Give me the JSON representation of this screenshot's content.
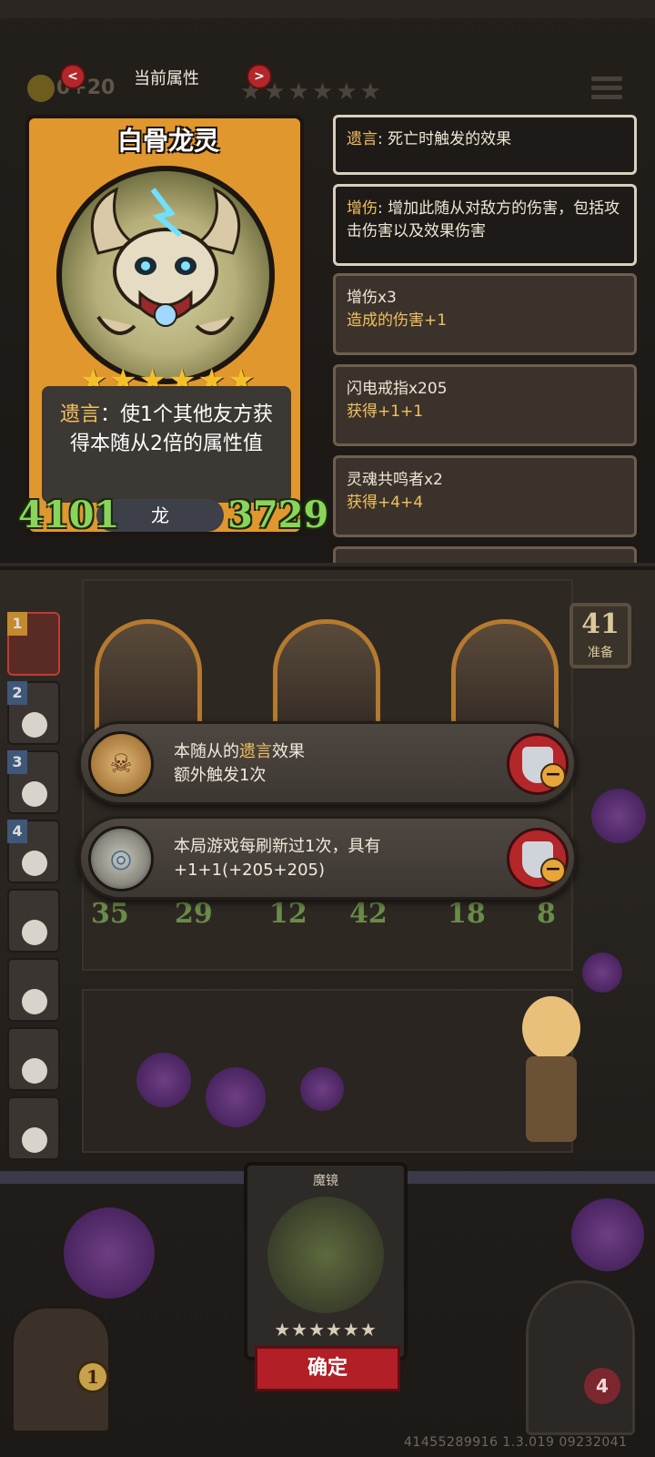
{
  "header": {
    "title": "当前属性",
    "coins": "0+20",
    "tier_stars": "★★★★★★"
  },
  "hero_card": {
    "name": "白骨龙灵",
    "stars": "★★★★★★",
    "description": {
      "keyword": "遗言",
      "text": "：使1个其他友方获得本随从2倍的属性值"
    },
    "tribe": "龙",
    "attack": "4101",
    "health": "3729"
  },
  "keyword_definitions": [
    {
      "name": "遗言",
      "text": ": 死亡时触发的效果"
    },
    {
      "name": "增伤",
      "text": ": 增加此随从对敌方的伤害，包括攻击伤害以及效果伤害"
    }
  ],
  "buff_list": [
    {
      "title": "增伤x3",
      "detail": "造成的伤害+1"
    },
    {
      "title": "闪电戒指x205",
      "detail": "获得+1+1"
    },
    {
      "title": "灵魂共鸣者x2",
      "detail": "获得+4+4"
    }
  ],
  "board": {
    "ready_count": "41",
    "ready_label": "准备",
    "queue": [
      "1",
      "2",
      "3",
      "4"
    ],
    "minions": [
      {
        "attack": "35",
        "health": "29"
      },
      {
        "attack": "12",
        "health": "42"
      },
      {
        "attack": "18",
        "health": "8"
      }
    ]
  },
  "effects": [
    {
      "line1_prefix": "本随从的",
      "line1_keyword": "遗言",
      "line1_suffix": "效果",
      "line2": "额外触发1次",
      "icon": "skull-coin-icon"
    },
    {
      "line1": "本局游戏每刷新过1次，具有",
      "line2": "+1+1(+205+205)",
      "icon": "lightning-ring-icon"
    }
  ],
  "bottom": {
    "mirror_title": "魔镜",
    "mirror_stars": "★★★★★★",
    "confirm_label": "确定",
    "chest_count": "1",
    "lives": "4",
    "build_id": "41455289916 1.3.019 09232041"
  },
  "colors": {
    "keyword": "#f0c060",
    "stat_green": "#8bd45a",
    "button_red": "#b21f26",
    "card_gold": "#e0972e"
  }
}
